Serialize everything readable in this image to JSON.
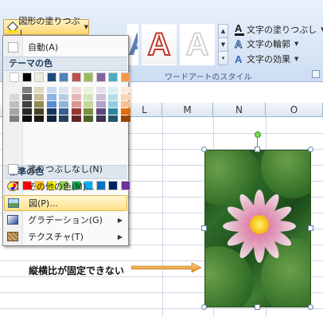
{
  "ribbon": {
    "fill_button_label": "図形の塗りつぶし",
    "wordart_cmd_fill": "文字の塗りつぶし",
    "wordart_cmd_outline": "文字の輪郭",
    "wordart_cmd_effects": "文字の効果",
    "wordart_style_glyph": "A",
    "group_label": "ワードアートのスタイル"
  },
  "sheet": {
    "columns": [
      "L",
      "M",
      "N",
      "O"
    ],
    "callout_text": "縦横比が固定できない"
  },
  "menu": {
    "automatic_label": "自動(A)",
    "theme_colors_header": "テーマの色",
    "standard_colors_header": "標準の色",
    "no_fill_label": "塗りつぶしなし(N)",
    "more_colors_label": "その他の色(M)...",
    "picture_label": "図(P)...",
    "gradient_label": "グラデーション(G)",
    "texture_label": "テクスチャ(T)",
    "theme_colors": [
      [
        "#ffffff",
        "#f2f2f2",
        "#d8d8d8",
        "#bfbfbf",
        "#a5a5a5",
        "#7f7f7f"
      ],
      [
        "#000000",
        "#7f7f7f",
        "#595959",
        "#3f3f3f",
        "#262626",
        "#0c0c0c"
      ],
      [
        "#eeece1",
        "#ddd9c3",
        "#c4bd97",
        "#938953",
        "#494429",
        "#1d1b10"
      ],
      [
        "#1f497d",
        "#c6d9f0",
        "#8db3e2",
        "#548dd4",
        "#17365d",
        "#0f243e"
      ],
      [
        "#4f81bd",
        "#dbe5f1",
        "#b8cce4",
        "#95b3d7",
        "#366092",
        "#244061"
      ],
      [
        "#c0504d",
        "#f2dcdb",
        "#e5b9b7",
        "#d99694",
        "#953734",
        "#632423"
      ],
      [
        "#9bbb59",
        "#ebf1dd",
        "#d7e3bc",
        "#c3d69b",
        "#76923c",
        "#4f6128"
      ],
      [
        "#8064a2",
        "#e5e0ec",
        "#ccc1d9",
        "#b2a2c7",
        "#5f497a",
        "#3f3151"
      ],
      [
        "#4bacc6",
        "#dbeef3",
        "#b7dde8",
        "#92cddc",
        "#31859b",
        "#205867"
      ],
      [
        "#f79646",
        "#fdeada",
        "#fbd5b5",
        "#fac08f",
        "#e36c09",
        "#974806"
      ]
    ],
    "standard_colors": [
      "#c00000",
      "#ff0000",
      "#ffc000",
      "#ffff00",
      "#92d050",
      "#00b050",
      "#00b0f0",
      "#0070c0",
      "#002060",
      "#7030a0"
    ]
  }
}
